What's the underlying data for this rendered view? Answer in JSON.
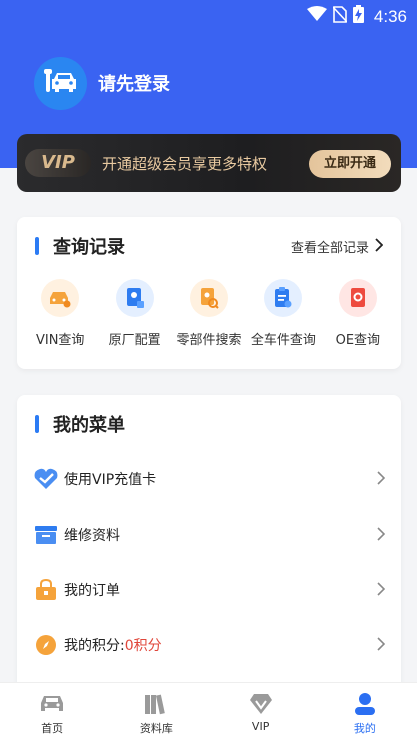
{
  "status_bar": {
    "time": "4:36"
  },
  "header": {
    "login_text": "请先登录"
  },
  "vip_banner": {
    "logo": "VIP",
    "promo_text": "开通超级会员享更多特权",
    "button_label": "立即开通"
  },
  "history": {
    "title": "查询记录",
    "view_all": "查看全部记录",
    "items": [
      {
        "label": "VIN查询",
        "icon": "vin-icon"
      },
      {
        "label": "原厂配置",
        "icon": "config-icon"
      },
      {
        "label": "零部件搜索",
        "icon": "parts-search-icon"
      },
      {
        "label": "全车件查询",
        "icon": "full-parts-icon"
      },
      {
        "label": "OE查询",
        "icon": "oe-icon"
      }
    ]
  },
  "menu": {
    "title": "我的菜单",
    "items": [
      {
        "label": "使用VIP充值卡",
        "icon": "vip-card-icon"
      },
      {
        "label": "维修资料",
        "icon": "repair-docs-icon"
      },
      {
        "label": "我的订单",
        "icon": "orders-icon"
      },
      {
        "label": "我的积分:",
        "value": "0积分",
        "icon": "points-icon"
      }
    ]
  },
  "bottom_nav": [
    {
      "label": "首页",
      "icon": "car-icon"
    },
    {
      "label": "资料库",
      "icon": "library-icon"
    },
    {
      "label": "VIP",
      "icon": "diamond-icon"
    },
    {
      "label": "我的",
      "icon": "user-icon",
      "active": true
    }
  ],
  "colors": {
    "primary": "#3a63f2",
    "accent": "#2b7bf4",
    "vip_gold": "#e8c9a0",
    "points_red": "#e0463a"
  }
}
